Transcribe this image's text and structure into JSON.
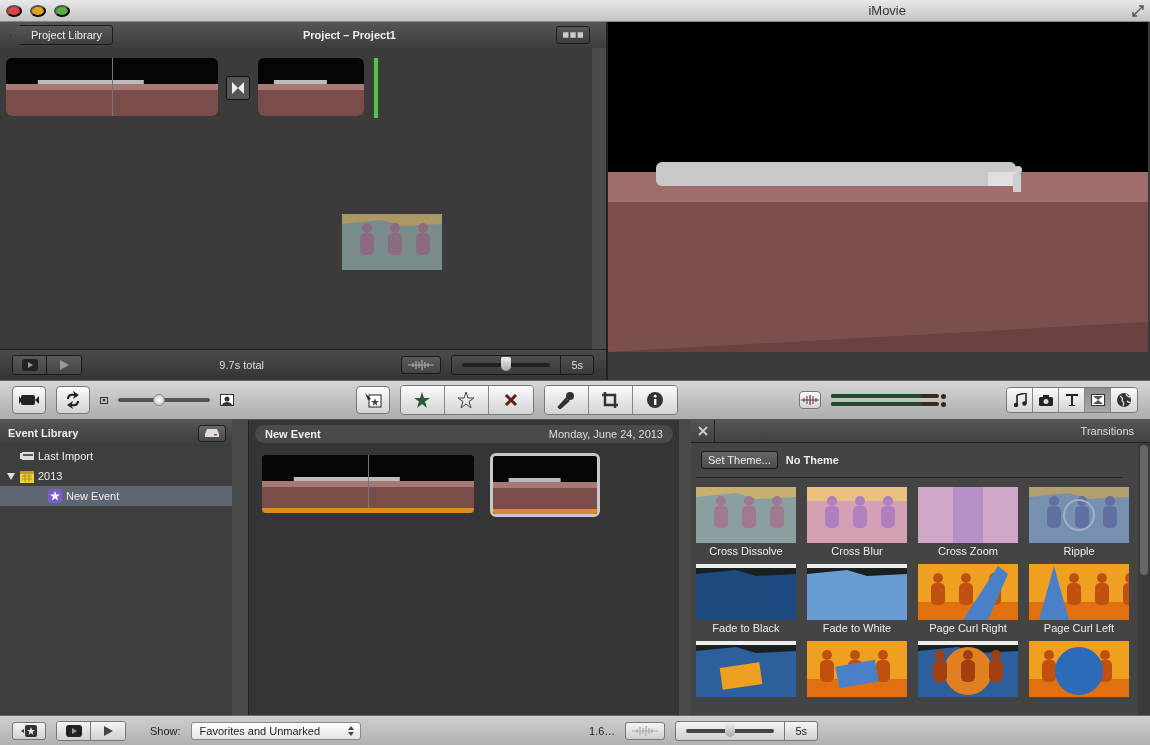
{
  "window": {
    "title": "iMovie"
  },
  "project": {
    "back_button": "Project Library",
    "title": "Project – Project1",
    "total": "9.7s total",
    "zoom_slider": {
      "level": 0.5
    },
    "zoom_label": "5s",
    "clips": [
      {
        "kind": "long"
      },
      {
        "kind": "transition"
      },
      {
        "kind": "short"
      }
    ]
  },
  "toolbar": {
    "thumb_size_slider": {
      "level": 0.45
    },
    "meters": [
      {
        "level": 0.83
      },
      {
        "level": 0.83
      }
    ],
    "rating_buttons": [
      {
        "kind": "favorite"
      },
      {
        "kind": "unfavorite"
      },
      {
        "kind": "reject"
      }
    ],
    "tool_buttons": [
      {
        "kind": "voiceover"
      },
      {
        "kind": "crop"
      },
      {
        "kind": "inspector"
      }
    ],
    "browser_buttons": [
      {
        "kind": "music",
        "selected": false
      },
      {
        "kind": "photos",
        "selected": false
      },
      {
        "kind": "titles",
        "selected": false
      },
      {
        "kind": "transitions",
        "selected": true
      },
      {
        "kind": "maps",
        "selected": false
      }
    ]
  },
  "event_library": {
    "title": "Event Library",
    "items": [
      {
        "label": "Last Import",
        "kind": "import",
        "selected": false
      },
      {
        "label": "2013",
        "kind": "year",
        "selected": false,
        "expanded": true,
        "children": [
          {
            "label": "New Event",
            "kind": "event",
            "selected": true
          }
        ]
      }
    ]
  },
  "event": {
    "title": "New Event",
    "date": "Monday, June 24, 2013",
    "clips": [
      {
        "kind": "long",
        "selected": false
      },
      {
        "kind": "short",
        "selected": true
      }
    ]
  },
  "transitions": {
    "title": "Transitions",
    "set_theme": "Set Theme...",
    "theme": "No Theme",
    "items": [
      {
        "label": "Cross Dissolve"
      },
      {
        "label": "Cross Blur"
      },
      {
        "label": "Cross Zoom"
      },
      {
        "label": "Ripple"
      },
      {
        "label": "Fade to Black"
      },
      {
        "label": "Fade to White"
      },
      {
        "label": "Page Curl Right"
      },
      {
        "label": "Page Curl Left"
      },
      {
        "kind": "picture"
      },
      {
        "kind": "picture"
      },
      {
        "kind": "picture"
      },
      {
        "kind": "picture"
      }
    ]
  },
  "bottom_bar": {
    "show_label": "Show:",
    "filter": "Favorites and Unmarked",
    "duration": "1.6…",
    "zoom_slider": {
      "level": 0.5
    },
    "zoom_label": "5s"
  }
}
